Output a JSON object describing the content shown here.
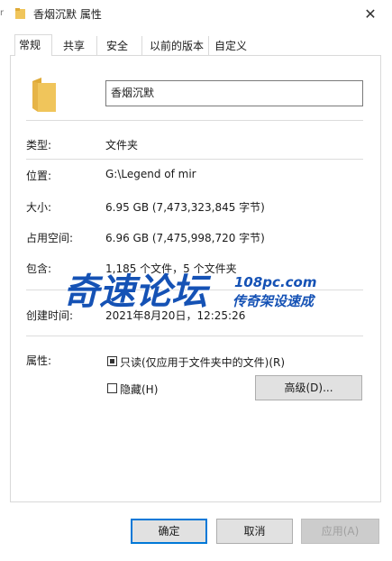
{
  "window": {
    "title": "香烟沉默 属性",
    "close_glyph": "✕",
    "edge_glyph": "r"
  },
  "tabs": [
    {
      "label": "常规",
      "selected": true
    },
    {
      "label": "共享",
      "selected": false
    },
    {
      "label": "安全",
      "selected": false
    },
    {
      "label": "以前的版本",
      "selected": false
    },
    {
      "label": "自定义",
      "selected": false
    }
  ],
  "general": {
    "name_value": "香烟沉默",
    "type_label": "类型:",
    "type_value": "文件夹",
    "location_label": "位置:",
    "location_value": "G:\\Legend of mir",
    "size_label": "大小:",
    "size_value": "6.95 GB (7,473,323,845 字节)",
    "size_on_disk_label": "占用空间:",
    "size_on_disk_value": "6.96 GB (7,475,998,720 字节)",
    "contains_label": "包含:",
    "contains_value": "1,185 个文件，5 个文件夹",
    "created_label": "创建时间:",
    "created_value": "2021年8月20日，12:25:26",
    "attributes_label": "属性:",
    "readonly_label": "只读(仅应用于文件夹中的文件)(R)",
    "readonly_state": "indeterminate",
    "hidden_label": "隐藏(H)",
    "hidden_checked": false,
    "advanced_label": "高级(D)..."
  },
  "watermark": {
    "main_text": "奇速论坛",
    "domain": "108pc.com",
    "slogan": "传奇架设速成"
  },
  "buttons": {
    "ok": "确定",
    "cancel": "取消",
    "apply": "应用(A)",
    "apply_enabled": false
  },
  "colors": {
    "folder": "#f0c55b",
    "folder_dark": "#dfaa37",
    "watermark_blue": "#1552b5",
    "accent": "#0078d7"
  }
}
